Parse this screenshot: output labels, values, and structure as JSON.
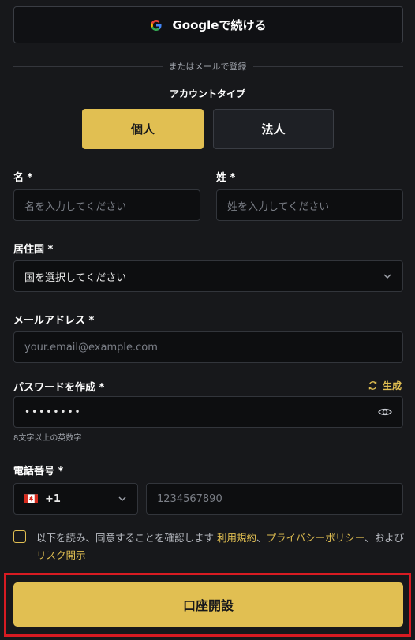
{
  "google_button": {
    "label": "Googleで続ける"
  },
  "divider": {
    "text": "またはメールで登録"
  },
  "account_type": {
    "title": "アカウントタイプ",
    "options": [
      "個人",
      "法人"
    ],
    "selected": "個人"
  },
  "first_name": {
    "label": "名 *",
    "placeholder": "名を入力してください"
  },
  "last_name": {
    "label": "姓 *",
    "placeholder": "姓を入力してください"
  },
  "country": {
    "label": "居住国 *",
    "placeholder": "国を選択してください"
  },
  "email": {
    "label": "メールアドレス *",
    "placeholder": "your.email@example.com"
  },
  "password": {
    "label": "パスワードを作成 *",
    "generate_label": "生成",
    "masked_value": "••••••••",
    "hint": "8文字以上の英数字"
  },
  "phone": {
    "label": "電話番号 *",
    "country_code": "+1",
    "flag": "canada-flag-icon",
    "placeholder": "1234567890"
  },
  "terms": {
    "prefix": "以下を読み、同意することを確認します ",
    "terms_link": "利用規約",
    "sep1": "、",
    "privacy_link": "プライバシーポリシー",
    "sep2": "、および ",
    "risk_link": "リスク開示"
  },
  "submit": {
    "label": "口座開設"
  },
  "colors": {
    "accent": "#e1bf52",
    "background": "#17181b",
    "field": "#0d0e10",
    "highlight": "#d81b22"
  }
}
